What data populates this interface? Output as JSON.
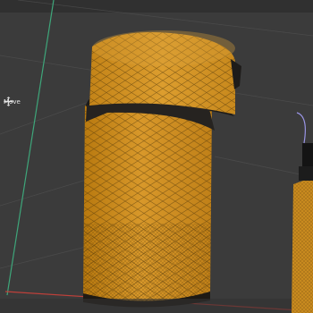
{
  "viewport": {
    "active_tool": "Move",
    "tool_icon": "move-icon",
    "object_color": "#d2911c",
    "background_color": "#3b3b3b",
    "axis_colors": {
      "x": "#c0403a",
      "y": "#3ea67a"
    }
  }
}
